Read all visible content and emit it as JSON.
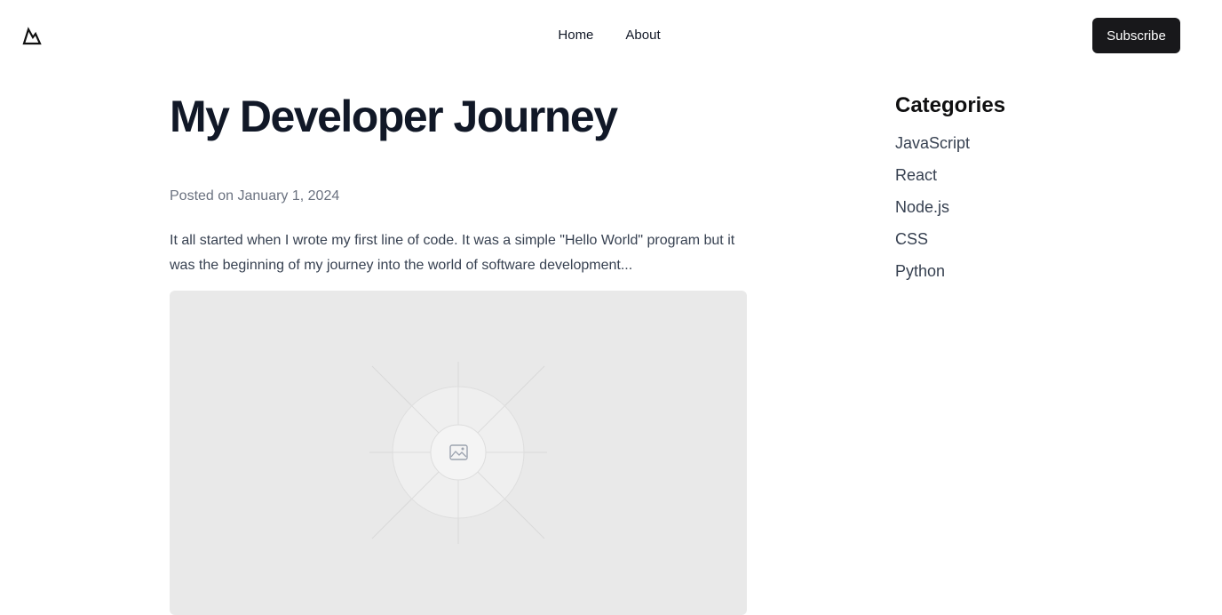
{
  "header": {
    "logo_icon": "mountain-logo-icon",
    "nav": [
      {
        "label": "Home"
      },
      {
        "label": "About"
      }
    ],
    "subscribe_label": "Subscribe"
  },
  "post": {
    "title": "My Developer Journey",
    "posted_on": "Posted on January 1, 2024",
    "excerpt": "It all started when I wrote my first line of code. It was a simple \"Hello World\" program but it was the beginning of my journey into the world of software development...",
    "image_icon": "image-placeholder-icon"
  },
  "sidebar": {
    "heading": "Categories",
    "categories": [
      "JavaScript",
      "React",
      "Node.js",
      "CSS",
      "Python"
    ]
  },
  "colors": {
    "button_bg": "#18181b",
    "placeholder_bg": "#e9e9e9",
    "muted_text": "#6b7280"
  }
}
